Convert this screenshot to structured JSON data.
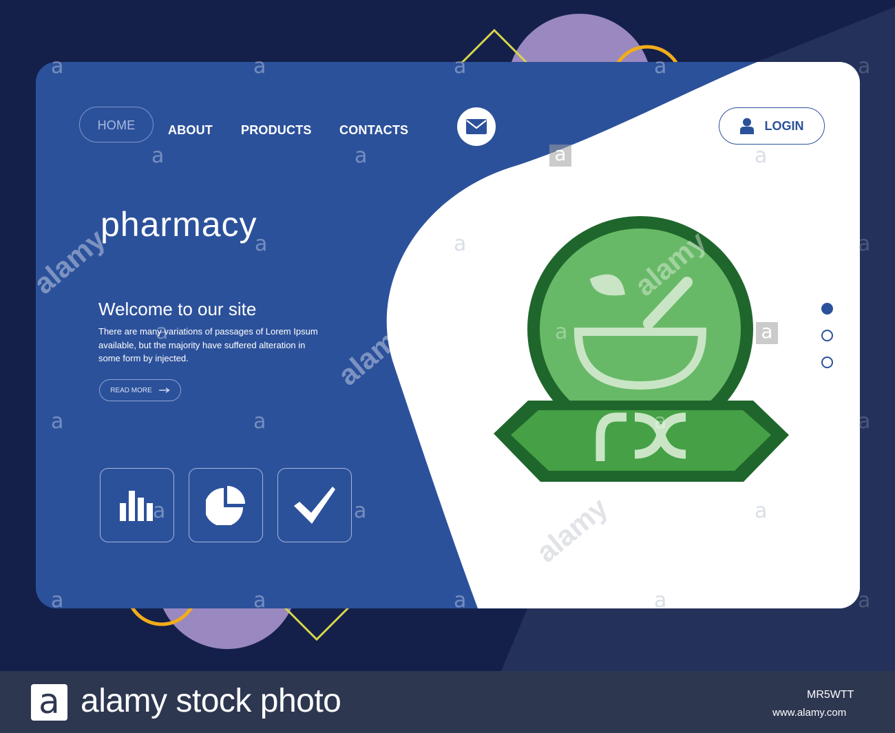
{
  "nav": {
    "items": [
      {
        "label": "HOME",
        "active": true
      },
      {
        "label": "ABOUT"
      },
      {
        "label": "PRODUCTS"
      },
      {
        "label": "CONTACTS"
      }
    ],
    "mail_icon": "envelope-icon",
    "login_label": "LOGIN",
    "login_icon": "user-icon"
  },
  "hero": {
    "title": "pharmacy",
    "welcome": "Welcome to our site",
    "body": "There are many variations of passages of Lorem Ipsum available, but the majority have suffered alteration in some form by injected.",
    "read_more": "READ MORE"
  },
  "features": [
    {
      "icon": "bar-chart-icon"
    },
    {
      "icon": "pie-chart-icon"
    },
    {
      "icon": "checkmark-icon"
    }
  ],
  "illustration": {
    "icon": "rx-mortar-pestle-icon",
    "label": "rx"
  },
  "slider": {
    "count": 3,
    "active": 0
  },
  "colors": {
    "primary": "#2c519b",
    "background": "#14204a",
    "green_dark": "#1f662c",
    "green": "#45a046",
    "green_light": "#68b967"
  },
  "footer": {
    "logo_letter": "a",
    "brand": "alamy stock photo",
    "image_id": "MR5WTT",
    "url": "www.alamy.com"
  },
  "watermarks": {
    "letter": "a",
    "word": "alamy"
  }
}
